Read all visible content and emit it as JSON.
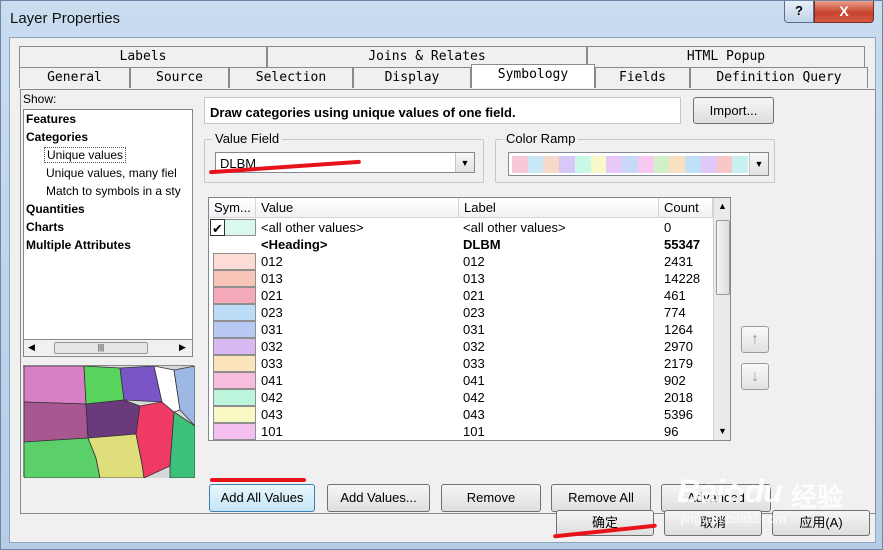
{
  "window": {
    "title": "Layer Properties",
    "help_glyph": "?",
    "close_glyph": "X"
  },
  "tabs_row1": [
    "Labels",
    "Joins & Relates",
    "HTML Popup"
  ],
  "tabs_row2": [
    "General",
    "Source",
    "Selection",
    "Display",
    "Symbology",
    "Fields",
    "Definition Query"
  ],
  "active_tab": "Symbology",
  "show": {
    "label": "Show:",
    "tree": [
      {
        "label": "Features",
        "kind": "bold"
      },
      {
        "label": "Categories",
        "kind": "bold"
      },
      {
        "label": "Unique values",
        "kind": "selected"
      },
      {
        "label": "Unique values, many fiel",
        "kind": "sub"
      },
      {
        "label": "Match to symbols in a sty",
        "kind": "sub"
      },
      {
        "label": "Quantities",
        "kind": "bold"
      },
      {
        "label": "Charts",
        "kind": "bold"
      },
      {
        "label": "Multiple Attributes",
        "kind": "bold"
      }
    ]
  },
  "description": "Draw categories using unique values of one field.",
  "import_label": "Import...",
  "value_field": {
    "group_label": "Value Field",
    "value": "DLBM"
  },
  "color_ramp": {
    "group_label": "Color Ramp",
    "colors": [
      "#f7c8d8",
      "#c8e8f8",
      "#f8d8c8",
      "#d8c8f8",
      "#c8f8e8",
      "#f8f8c8",
      "#e8c8f8",
      "#c8d8f8",
      "#f8c8f0",
      "#d0f0c8",
      "#f8e0c0",
      "#c0e0f8",
      "#e0c8f8",
      "#f8c8c8",
      "#c8f0f0"
    ]
  },
  "table": {
    "headers": [
      "Sym...",
      "Value",
      "Label",
      "Count"
    ],
    "rows": [
      {
        "checked": true,
        "color": "#d8f8f0",
        "value": "<all other values>",
        "label": "<all other values>",
        "count": "0"
      },
      {
        "heading": true,
        "value": "<Heading>",
        "label": "DLBM",
        "count": "55347"
      },
      {
        "color": "#fcdcd4",
        "value": "012",
        "label": "012",
        "count": "2431"
      },
      {
        "color": "#f8c4b8",
        "value": "013",
        "label": "013",
        "count": "14228"
      },
      {
        "color": "#f4aab8",
        "value": "021",
        "label": "021",
        "count": "461"
      },
      {
        "color": "#bcdcf8",
        "value": "023",
        "label": "023",
        "count": "774"
      },
      {
        "color": "#b8c8f4",
        "value": "031",
        "label": "031",
        "count": "1264"
      },
      {
        "color": "#d8b8f0",
        "value": "032",
        "label": "032",
        "count": "2970"
      },
      {
        "color": "#fce4bc",
        "value": "033",
        "label": "033",
        "count": "2179"
      },
      {
        "color": "#f8bcdc",
        "value": "041",
        "label": "041",
        "count": "902"
      },
      {
        "color": "#bcf4dc",
        "value": "042",
        "label": "042",
        "count": "2018"
      },
      {
        "color": "#f8f8c4",
        "value": "043",
        "label": "043",
        "count": "5396"
      },
      {
        "color": "#f4c0f0",
        "value": "101",
        "label": "101",
        "count": "96"
      }
    ]
  },
  "buttons": {
    "add_all_values": "Add All Values",
    "add_values": "Add Values...",
    "remove": "Remove",
    "remove_all": "Remove All",
    "advanced": "Advanced"
  },
  "side_buttons": {
    "up_glyph": "↑",
    "down_glyph": "↓"
  },
  "footer": {
    "ok": "确定",
    "cancel": "取消",
    "apply": "应用(A)"
  },
  "watermark": {
    "brand": "Bai",
    "brand2": "du",
    "suffix": "经验",
    "url": "jingyan.baidu.com"
  }
}
